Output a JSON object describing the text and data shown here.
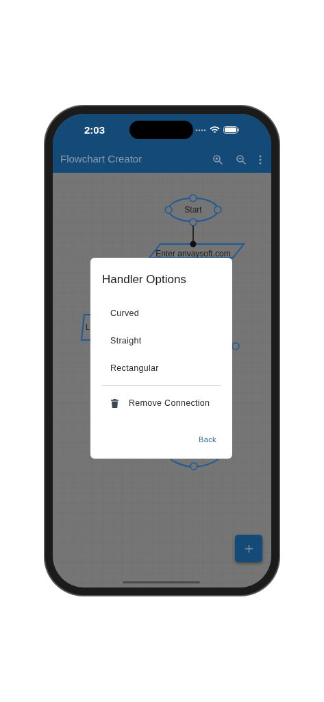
{
  "status_bar": {
    "time": "2:03"
  },
  "app_bar": {
    "title": "Flowchart Creator"
  },
  "canvas": {
    "nodes": [
      {
        "kind": "terminal",
        "label": "Start"
      },
      {
        "kind": "input",
        "label": "Enter anvaysoft.com"
      },
      {
        "kind": "partial",
        "label": "L"
      }
    ]
  },
  "dialog": {
    "title": "Handler Options",
    "options": [
      "Curved",
      "Straight",
      "Rectangular"
    ],
    "action": "Remove Connection",
    "button": "Back"
  }
}
